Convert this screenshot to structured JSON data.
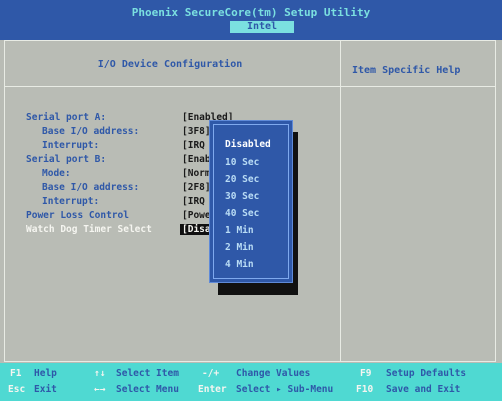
{
  "header": {
    "title": "Phoenix SecureCore(tm) Setup Utility",
    "tab": "Intel"
  },
  "panel": {
    "title": "I/O Device Configuration",
    "help_title": "Item Specific Help"
  },
  "settings": [
    {
      "label": "Serial port A:",
      "value": "[Enabled]"
    },
    {
      "label": "Base I/O address:",
      "value": "[3F8]"
    },
    {
      "label": "Interrupt:",
      "value": "[IRQ"
    },
    {
      "label": "Serial port B:",
      "value": "[Enab"
    },
    {
      "label": "Mode:",
      "value": "[Norm"
    },
    {
      "label": "Base I/O address:",
      "value": "[2F8]"
    },
    {
      "label": "Interrupt:",
      "value": "[IRQ"
    },
    {
      "label": "Power Loss Control",
      "value": "[Power"
    },
    {
      "label": "Watch Dog Timer Select",
      "value": "[Disa"
    }
  ],
  "popup": {
    "options": [
      "Disabled",
      "10  Sec",
      "20  Sec",
      "30  Sec",
      "40  Sec",
      "1   Min",
      "2   Min",
      "4   Min"
    ],
    "selected_index": 0
  },
  "footer": {
    "items": [
      {
        "key": "F1",
        "desc": "Help"
      },
      {
        "key": "↑↓",
        "desc": "Select Item"
      },
      {
        "key": "-/+",
        "desc": "Change Values"
      },
      {
        "key": "F9",
        "desc": "Setup Defaults"
      },
      {
        "key": "Esc",
        "desc": "Exit"
      },
      {
        "key": "←→",
        "desc": "Select Menu"
      },
      {
        "key": "Enter",
        "desc": "Select ▸ Sub-Menu"
      },
      {
        "key": "F10",
        "desc": "Save and Exit"
      }
    ]
  },
  "colors": {
    "background": "#b9bcb5",
    "header": "#2f58a8",
    "accent": "#7be0e0",
    "footer": "#4fd9d2"
  }
}
